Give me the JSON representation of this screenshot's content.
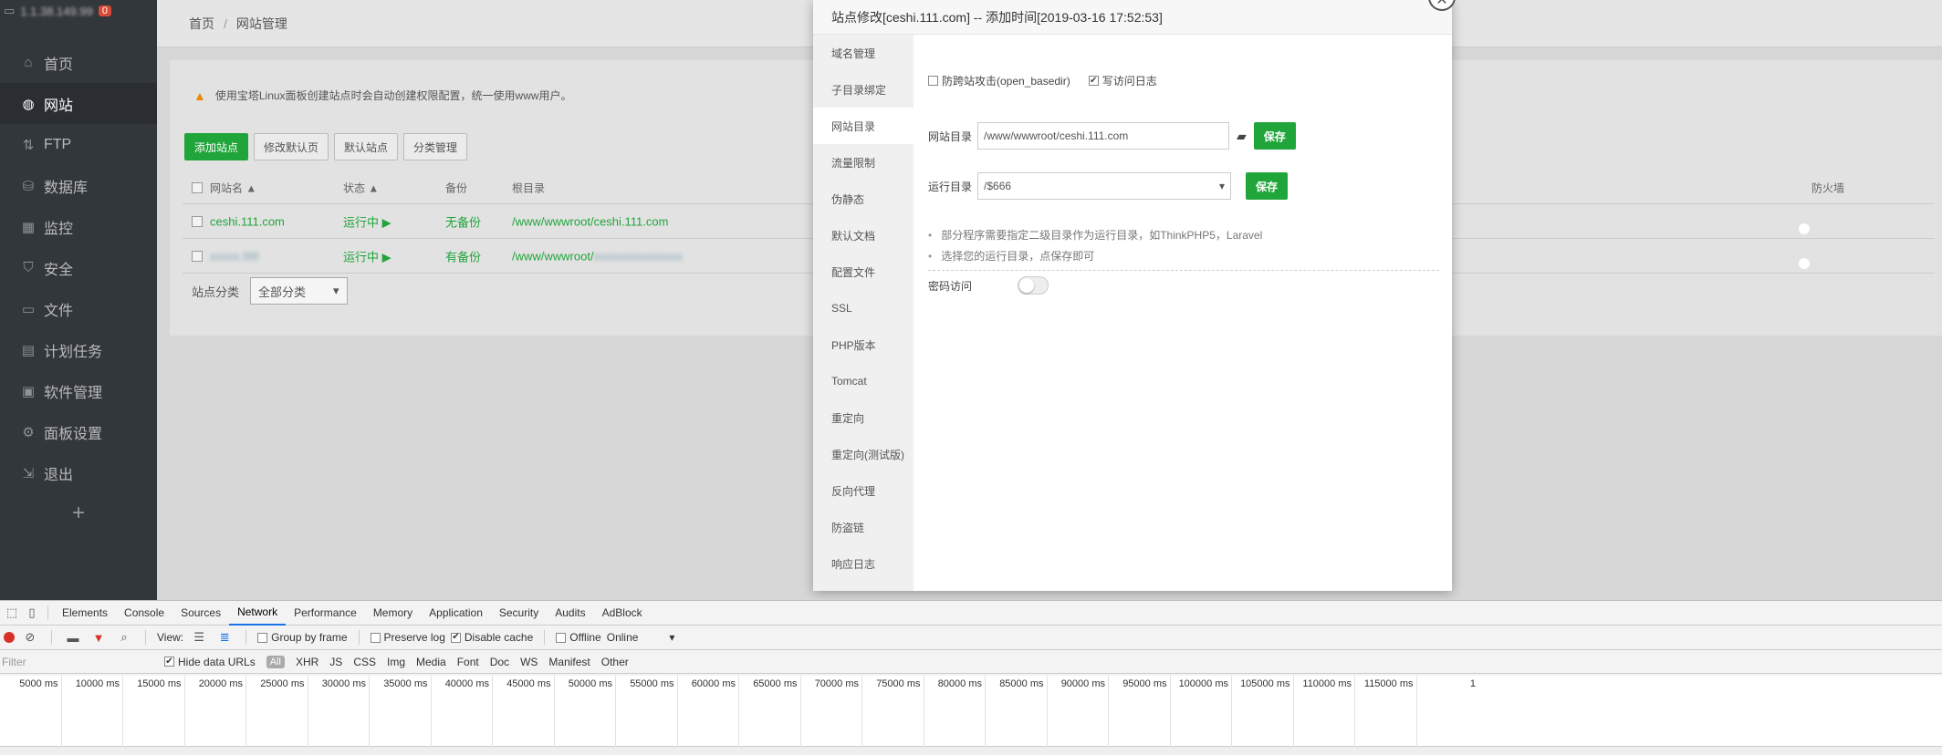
{
  "sidebar": {
    "ip": "1.1.38.149.99",
    "badge": "0",
    "items": [
      {
        "icon": "home-icon",
        "glyph": "⌂",
        "label": "首页"
      },
      {
        "icon": "globe-icon",
        "glyph": "◍",
        "label": "网站"
      },
      {
        "icon": "ftp-icon",
        "glyph": "⇅",
        "label": "FTP"
      },
      {
        "icon": "database-icon",
        "glyph": "⛁",
        "label": "数据库"
      },
      {
        "icon": "monitor-icon",
        "glyph": "▦",
        "label": "监控"
      },
      {
        "icon": "shield-icon",
        "glyph": "⛉",
        "label": "安全"
      },
      {
        "icon": "folder-icon",
        "glyph": "▭",
        "label": "文件"
      },
      {
        "icon": "calendar-icon",
        "glyph": "▤",
        "label": "计划任务"
      },
      {
        "icon": "grid-icon",
        "glyph": "▣",
        "label": "软件管理"
      },
      {
        "icon": "gear-icon",
        "glyph": "⚙",
        "label": "面板设置"
      },
      {
        "icon": "logout-icon",
        "glyph": "⇲",
        "label": "退出"
      }
    ],
    "add": "+"
  },
  "breadcrumb": {
    "home": "首页",
    "sep": "/",
    "current": "网站管理"
  },
  "notice": "使用宝塔Linux面板创建站点时会自动创建权限配置，统一使用www用户。",
  "toolbar": {
    "add": "添加站点",
    "edit_default": "修改默认页",
    "default_site": "默认站点",
    "category": "分类管理"
  },
  "table": {
    "headers": {
      "name": "网站名 ▲",
      "status": "状态 ▲",
      "backup": "备份",
      "root": "根目录",
      "firewall": "防火墙"
    },
    "rows": [
      {
        "name": "ceshi.111.com",
        "status": "运行中 ▶",
        "backup": "无备份",
        "root": "/www/wwwroot/ceshi.111.com"
      },
      {
        "name": "xxxxx.l98",
        "status": "运行中 ▶",
        "backup": "有备份",
        "root": "/www/wwwroot/",
        "root_hidden": "xxxxxxxxxxxxxxx"
      }
    ]
  },
  "category": {
    "label": "站点分类",
    "value": "全部分类"
  },
  "modal": {
    "title": "站点修改[ceshi.111.com] -- 添加时间[2019-03-16 17:52:53]",
    "close": "✕",
    "tabs": [
      "域名管理",
      "子目录绑定",
      "网站目录",
      "流量限制",
      "伪静态",
      "默认文档",
      "配置文件",
      "SSL",
      "PHP版本",
      "Tomcat",
      "重定向",
      "重定向(测试版)",
      "反向代理",
      "防盗链",
      "响应日志"
    ],
    "active_tab": 2,
    "checkbox1": "防跨站攻击(open_basedir)",
    "checkbox2": "写访问日志",
    "site_dir_label": "网站目录",
    "site_dir_value": "/www/wwwroot/ceshi.111.com",
    "run_dir_label": "运行目录",
    "run_dir_value": "/$666",
    "save": "保存",
    "tips": [
      "部分程序需要指定二级目录作为运行目录，如ThinkPHP5，Laravel",
      "选择您的运行目录，点保存即可"
    ],
    "password_label": "密码访问"
  },
  "devtools": {
    "tabs": [
      "Elements",
      "Console",
      "Sources",
      "Network",
      "Performance",
      "Memory",
      "Application",
      "Security",
      "Audits",
      "AdBlock"
    ],
    "active_tab": "Network",
    "view_label": "View:",
    "group_by_frame": "Group by frame",
    "preserve_log": "Preserve log",
    "disable_cache": "Disable cache",
    "offline": "Offline",
    "online": "Online",
    "filter_placeholder": "Filter",
    "hide_data_urls": "Hide data URLs",
    "types": [
      "All",
      "XHR",
      "JS",
      "CSS",
      "Img",
      "Media",
      "Font",
      "Doc",
      "WS",
      "Manifest",
      "Other"
    ],
    "ticks": [
      "5000 ms",
      "10000 ms",
      "15000 ms",
      "20000 ms",
      "25000 ms",
      "30000 ms",
      "35000 ms",
      "40000 ms",
      "45000 ms",
      "50000 ms",
      "55000 ms",
      "60000 ms",
      "65000 ms",
      "70000 ms",
      "75000 ms",
      "80000 ms",
      "85000 ms",
      "90000 ms",
      "95000 ms",
      "100000 ms",
      "105000 ms",
      "110000 ms",
      "115000 ms",
      "1"
    ]
  }
}
